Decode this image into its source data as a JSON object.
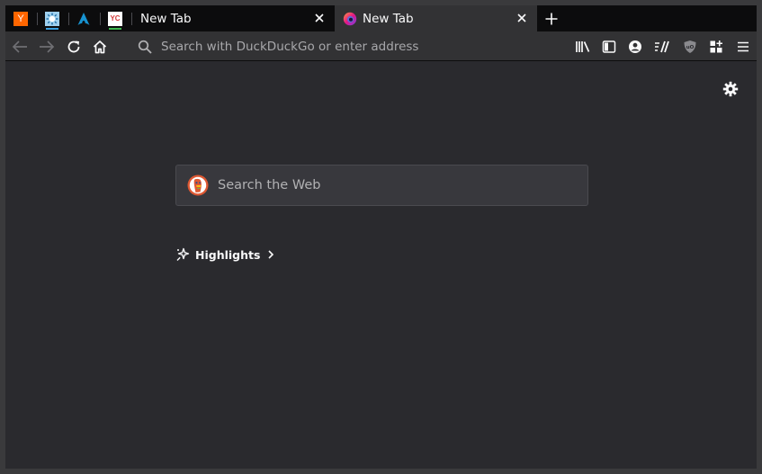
{
  "pinned_tabs": [
    {
      "icon": "y-combinator-icon",
      "letter": "Y",
      "color": "#ff6600"
    },
    {
      "icon": "gear-sun-icon",
      "color": "#3aa0e0",
      "underline": "#3aa0e0"
    },
    {
      "icon": "arch-linux-icon",
      "color": "#1793d1"
    },
    {
      "icon": "yc-icon",
      "letter": "YC",
      "color": "#d63a3a",
      "underline": "#3fb950"
    }
  ],
  "tabs": [
    {
      "title": "New Tab",
      "active": false,
      "close_icon": "close-icon"
    },
    {
      "title": "New Tab",
      "active": true,
      "favicon": "firefox-icon",
      "close_icon": "close-icon"
    }
  ],
  "new_tab_icon": "plus-icon",
  "navbar": {
    "back_icon": "back-arrow-icon",
    "forward_icon": "forward-arrow-icon",
    "reload_icon": "reload-icon",
    "home_icon": "home-icon",
    "urlbar_placeholder": "Search with DuckDuckGo or enter address",
    "toolbar_icons": [
      "library-icon",
      "sidebar-icon",
      "account-icon",
      "synced-tabs-icon",
      "ublock-icon",
      "extensions-icon",
      "menu-icon"
    ]
  },
  "newtab": {
    "settings_icon": "gear-icon",
    "search_placeholder": "Search the Web",
    "search_engine_icon": "duckduckgo-icon",
    "highlights_label": "Highlights",
    "highlights_icon": "sparkle-icon"
  },
  "colors": {
    "tabstrip_bg": "#0c0c0d",
    "toolbar_bg": "#323234",
    "content_bg": "#2a2a2e",
    "search_bg": "#38383d",
    "text": "#f9f9fa"
  }
}
